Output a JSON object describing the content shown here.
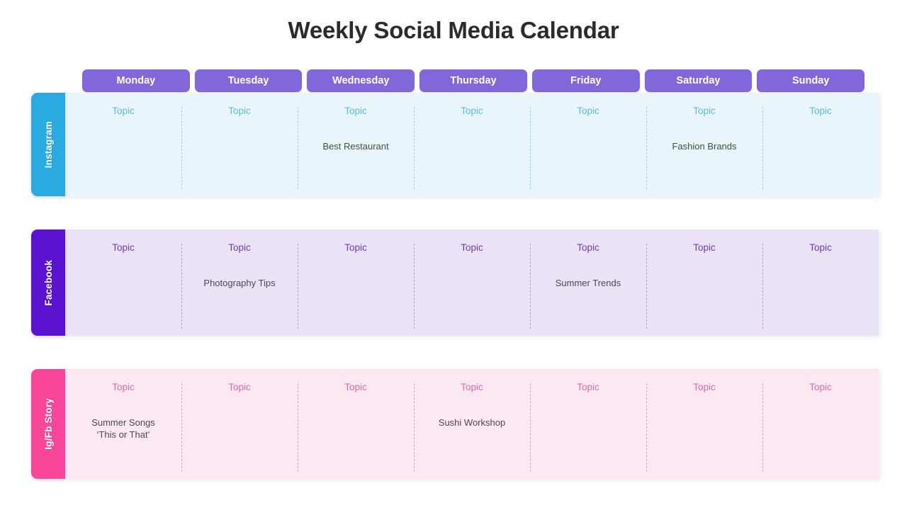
{
  "slide": {
    "title": "Weekly Social Media Calendar"
  },
  "days": [
    {
      "label": "Monday"
    },
    {
      "label": "Tuesday"
    },
    {
      "label": "Wednesday"
    },
    {
      "label": "Thursday"
    },
    {
      "label": "Friday"
    },
    {
      "label": "Saturday"
    },
    {
      "label": "Sunday"
    }
  ],
  "topic_label": "Topic",
  "colors": {
    "title": "#2b2b2b",
    "day_pill": "#8167d9",
    "instagram_tab": "#29abe2",
    "instagram_bg": "#e8f5fb",
    "instagram_topic": "#5bb9e0",
    "facebook_tab": "#5a13cf",
    "facebook_bg": "#eae3f8",
    "facebook_topic": "#6a3bbd",
    "story_tab": "#f8479b",
    "story_bg": "#fce8f2",
    "story_topic": "#e06aa8",
    "entry_text": "#4a4a4a"
  },
  "rows": [
    {
      "platform": "Instagram",
      "cells": [
        {
          "topic": "Topic",
          "entry": ""
        },
        {
          "topic": "Topic",
          "entry": ""
        },
        {
          "topic": "Topic",
          "entry": "Best Restaurant"
        },
        {
          "topic": "Topic",
          "entry": ""
        },
        {
          "topic": "Topic",
          "entry": ""
        },
        {
          "topic": "Topic",
          "entry": "Fashion Brands"
        },
        {
          "topic": "Topic",
          "entry": ""
        }
      ]
    },
    {
      "platform": "Facebook",
      "cells": [
        {
          "topic": "Topic",
          "entry": ""
        },
        {
          "topic": "Topic",
          "entry": "Photography Tips"
        },
        {
          "topic": "Topic",
          "entry": ""
        },
        {
          "topic": "Topic",
          "entry": ""
        },
        {
          "topic": "Topic",
          "entry": "Summer Trends"
        },
        {
          "topic": "Topic",
          "entry": ""
        },
        {
          "topic": "Topic",
          "entry": ""
        }
      ]
    },
    {
      "platform": "Ig/Fb Story",
      "cells": [
        {
          "topic": "Topic",
          "entry": "Summer Songs\n‘This or That’"
        },
        {
          "topic": "Topic",
          "entry": ""
        },
        {
          "topic": "Topic",
          "entry": ""
        },
        {
          "topic": "Topic",
          "entry": "Sushi Workshop"
        },
        {
          "topic": "Topic",
          "entry": ""
        },
        {
          "topic": "Topic",
          "entry": ""
        },
        {
          "topic": "Topic",
          "entry": ""
        }
      ]
    }
  ]
}
